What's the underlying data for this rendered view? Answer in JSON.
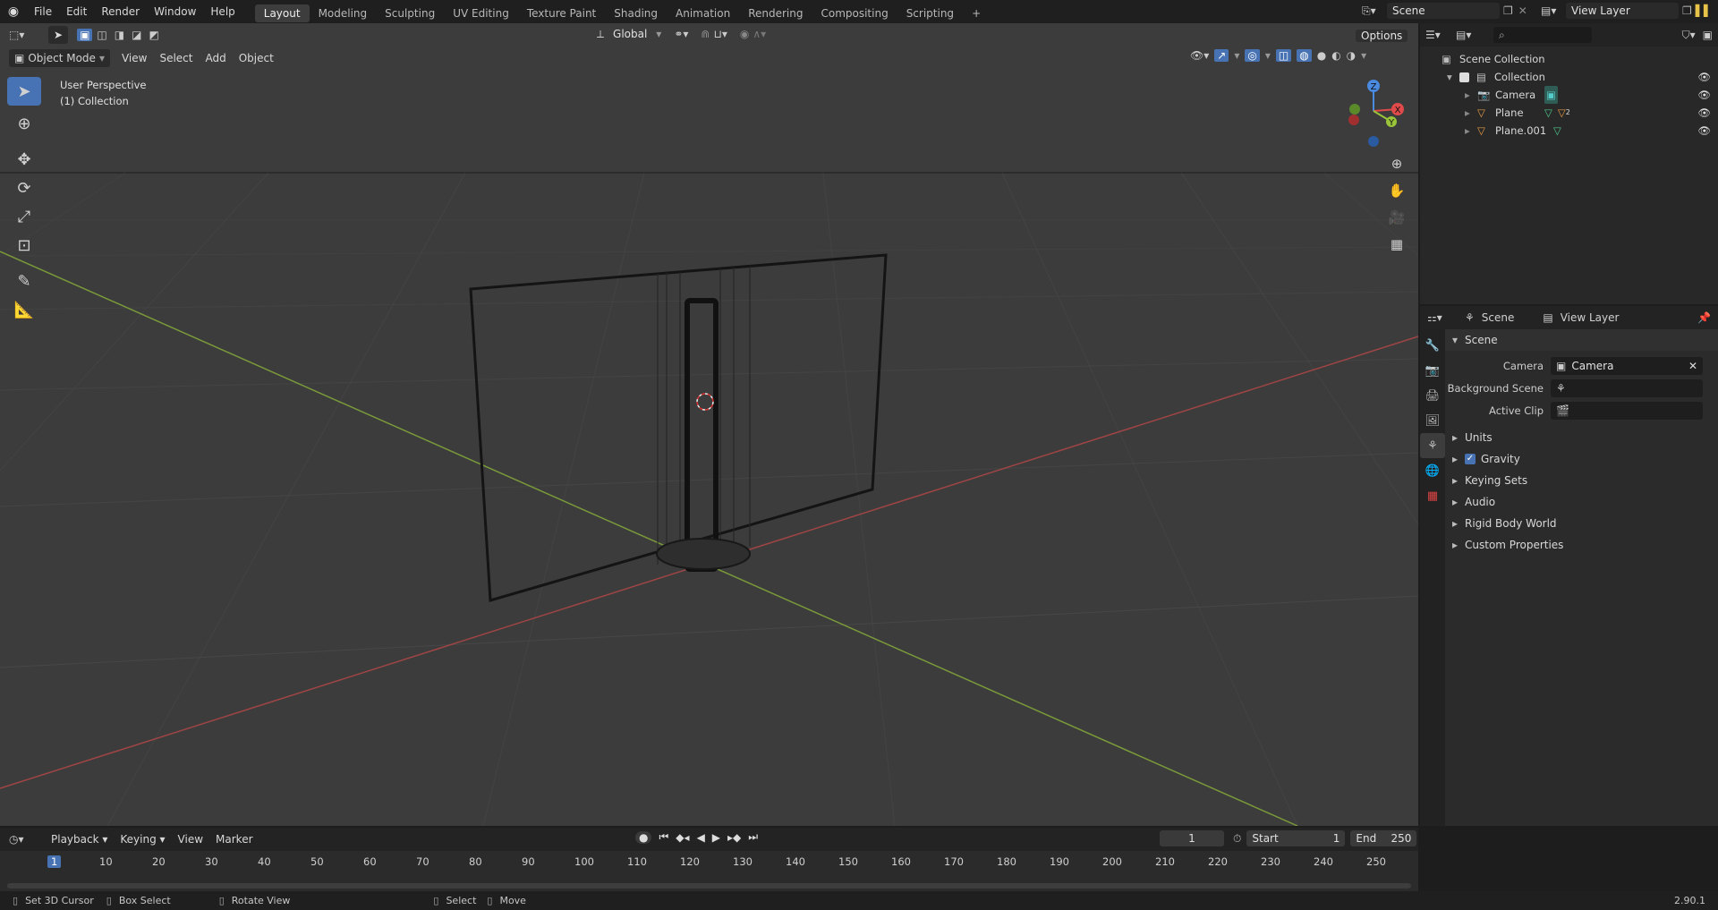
{
  "topbar": {
    "menus": [
      "File",
      "Edit",
      "Render",
      "Window",
      "Help"
    ],
    "workspaces": [
      "Layout",
      "Modeling",
      "Sculpting",
      "UV Editing",
      "Texture Paint",
      "Shading",
      "Animation",
      "Rendering",
      "Compositing",
      "Scripting"
    ],
    "active_workspace": "Layout",
    "add_tab": "+",
    "scene_name": "Scene",
    "view_layer": "View Layer"
  },
  "viewport": {
    "mode": "Object Mode",
    "menus": [
      "View",
      "Select",
      "Add",
      "Object"
    ],
    "orientation": "Global",
    "options": "Options",
    "info_line1": "User Perspective",
    "info_line2": "(1) Collection",
    "gizmo_labels": {
      "x": "X",
      "y": "Y",
      "z": "Z"
    },
    "accent": "#4772b3"
  },
  "outliner": {
    "search_placeholder": "",
    "root": "Scene Collection",
    "collection": "Collection",
    "objects": [
      "Camera",
      "Plane",
      "Plane.001"
    ],
    "plane_badge": "2"
  },
  "properties": {
    "header_scene": "Scene",
    "header_view_layer": "View Layer",
    "panel_title": "Scene",
    "camera_label": "Camera",
    "camera_value": "Camera",
    "background_label": "Background Scene",
    "clip_label": "Active Clip",
    "subpanels": [
      "Units",
      "Gravity",
      "Keying Sets",
      "Audio",
      "Rigid Body World",
      "Custom Properties"
    ],
    "gravity_checked": true
  },
  "timeline": {
    "menus": [
      "Playback",
      "Keying",
      "View",
      "Marker"
    ],
    "current_frame": "1",
    "start_label": "Start",
    "start": "1",
    "end_label": "End",
    "end": "250",
    "ticks": [
      "1",
      "10",
      "20",
      "30",
      "40",
      "50",
      "60",
      "70",
      "80",
      "90",
      "100",
      "110",
      "120",
      "130",
      "140",
      "150",
      "160",
      "170",
      "180",
      "190",
      "200",
      "210",
      "220",
      "230",
      "240",
      "250"
    ]
  },
  "statusbar": {
    "items": [
      "Set 3D Cursor",
      "Box Select",
      "Rotate View",
      "Select",
      "Move"
    ],
    "version": "2.90.1"
  }
}
